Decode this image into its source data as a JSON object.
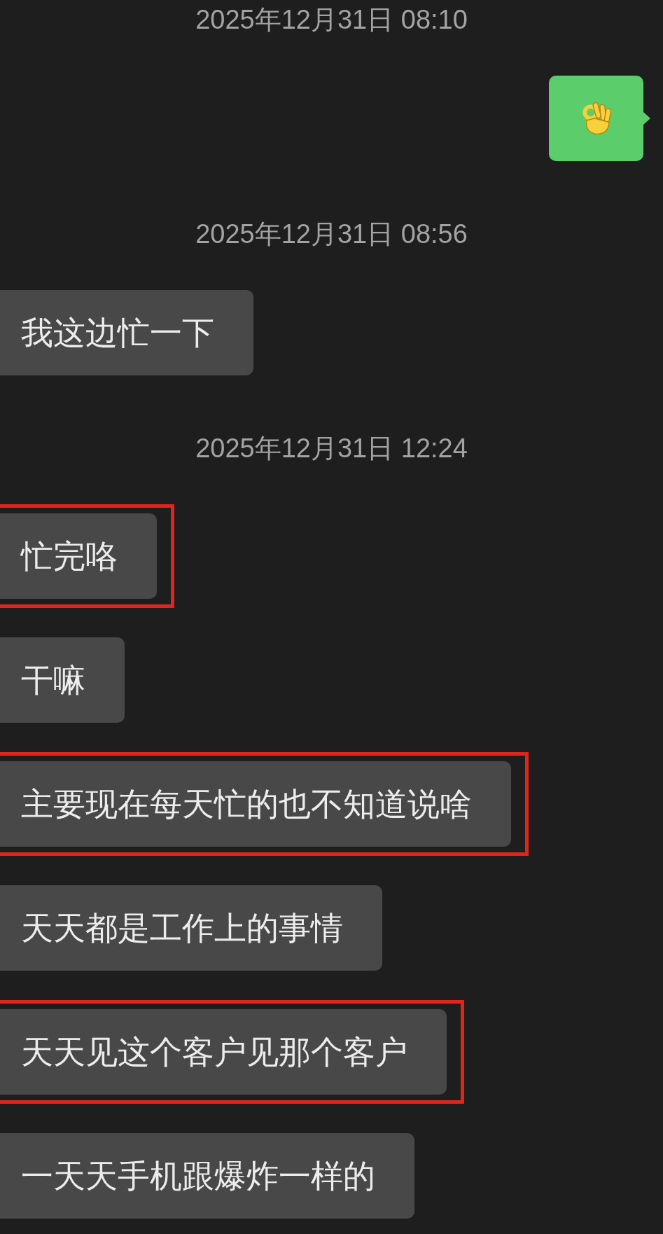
{
  "messages": [
    {
      "kind": "time",
      "text": "2025年12月31日 08:10"
    },
    {
      "kind": "sticker",
      "from_me": true
    },
    {
      "kind": "time",
      "text": "2025年12月31日 08:56"
    },
    {
      "kind": "text",
      "from_me": false,
      "text": "我这边忙一下",
      "highlighted": false
    },
    {
      "kind": "time",
      "text": "2025年12月31日 12:24"
    },
    {
      "kind": "text",
      "from_me": false,
      "text": "忙完咯",
      "highlighted": true
    },
    {
      "kind": "text",
      "from_me": false,
      "text": "干嘛",
      "highlighted": false
    },
    {
      "kind": "text",
      "from_me": false,
      "text": "主要现在每天忙的也不知道说啥",
      "highlighted": true
    },
    {
      "kind": "text",
      "from_me": false,
      "text": "天天都是工作上的事情",
      "highlighted": false
    },
    {
      "kind": "text",
      "from_me": false,
      "text": "天天见这个客户见那个客户",
      "highlighted": true
    },
    {
      "kind": "text",
      "from_me": false,
      "text": "一天天手机跟爆炸一样的",
      "highlighted": false
    }
  ]
}
